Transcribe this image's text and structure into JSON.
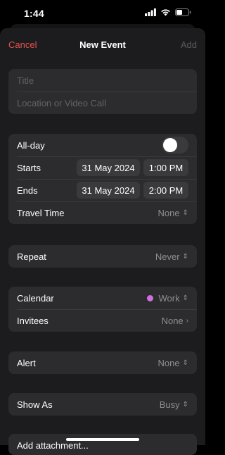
{
  "status": {
    "time": "1:44"
  },
  "nav": {
    "cancel": "Cancel",
    "title": "New Event",
    "add": "Add"
  },
  "details": {
    "title_placeholder": "Title",
    "location_placeholder": "Location or Video Call"
  },
  "dates": {
    "allday_label": "All-day",
    "allday_on": false,
    "starts_label": "Starts",
    "starts_date": "31 May 2024",
    "starts_time": "1:00 PM",
    "ends_label": "Ends",
    "ends_date": "31 May 2024",
    "ends_time": "2:00 PM",
    "travel_label": "Travel Time",
    "travel_value": "None"
  },
  "repeat": {
    "label": "Repeat",
    "value": "Never"
  },
  "calendar": {
    "label": "Calendar",
    "value": "Work",
    "color": "#d070e0",
    "invitees_label": "Invitees",
    "invitees_value": "None"
  },
  "alert": {
    "label": "Alert",
    "value": "None"
  },
  "showas": {
    "label": "Show As",
    "value": "Busy"
  },
  "attachment": {
    "label": "Add attachment..."
  },
  "colors": {
    "accent": "#e5524e",
    "background": "#000000",
    "card": "#2c2c2e"
  }
}
